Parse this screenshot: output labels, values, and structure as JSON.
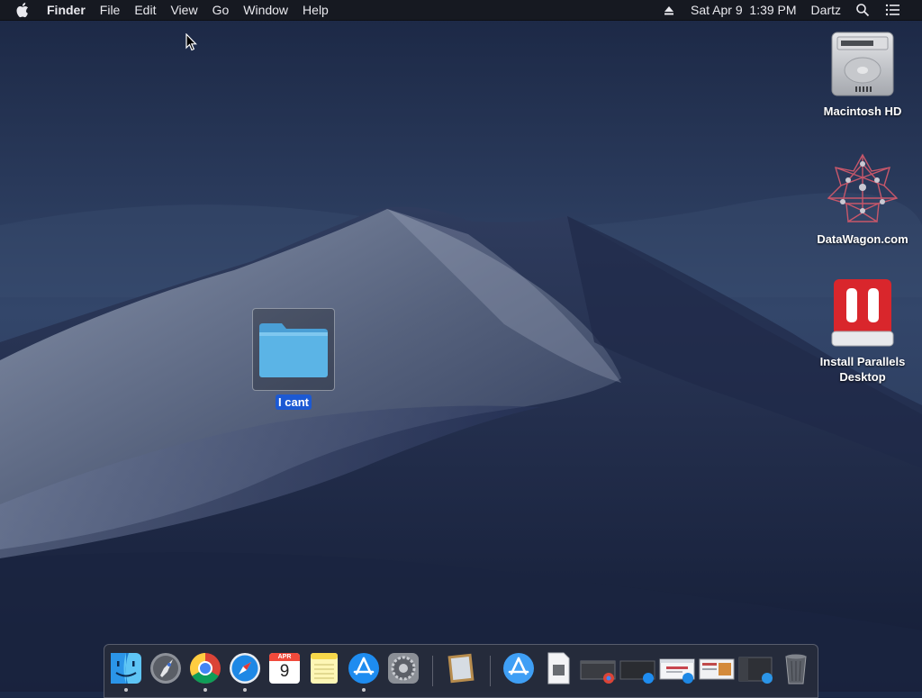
{
  "menubar": {
    "app_name": "Finder",
    "menus": [
      "File",
      "Edit",
      "View",
      "Go",
      "Window",
      "Help"
    ],
    "datetime": "Sat Apr 9  1:39 PM",
    "user": "Dartz"
  },
  "desktop": {
    "icons": [
      {
        "label": "Macintosh HD",
        "icon": "hard-drive-icon"
      },
      {
        "label": "DataWagon.com",
        "icon": "datawagon-app-icon"
      },
      {
        "label": "Install Parallels Desktop",
        "icon": "parallels-installer-icon"
      }
    ],
    "folder": {
      "label": "I cant",
      "selected": true
    }
  },
  "dock": {
    "apps": [
      "finder-icon",
      "launchpad-icon",
      "chrome-icon",
      "safari-icon",
      "calendar-icon",
      "notes-icon",
      "app-store-icon",
      "system-preferences-icon",
      "archive-utility-icon",
      "applications-folder-icon",
      "document-icon",
      "chrome-window-thumbnail",
      "app-store-window-thumbnail",
      "safari-window-thumbnail",
      "preview-window-thumbnail",
      "finder-window-thumbnail",
      "trash-icon"
    ],
    "calendar_month": "APR",
    "calendar_day": "9"
  },
  "colors": {
    "selection": "#1c59d3",
    "folder": "#5bb4e6",
    "parallels_red": "#d9262c"
  }
}
